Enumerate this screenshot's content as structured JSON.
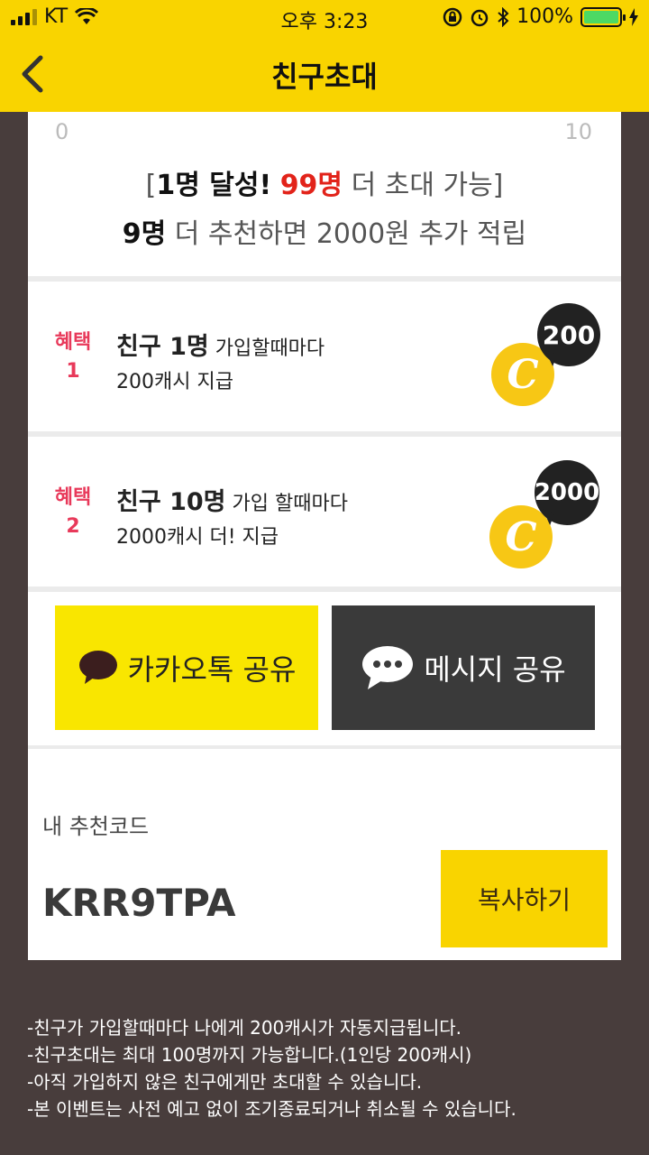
{
  "status": {
    "carrier": "KT",
    "time": "오후 3:23",
    "battery": "100%"
  },
  "nav": {
    "title": "친구초대"
  },
  "progress": {
    "min_label": "0",
    "max_label": "10",
    "line1_open": "[",
    "line1_bold": "1명 달성!",
    "line1_red": "99명",
    "line1_rest": "더 초대 가능",
    "line1_close": "]",
    "line2_bold": "9명",
    "line2_rest": "더 추천하면 2000원 추가 적립"
  },
  "benefits": [
    {
      "label_top": "혜택",
      "label_num": "1",
      "bold": "친구 1명",
      "rest": "가입할때마다",
      "line2": "200캐시 지급",
      "bubble": "200",
      "coin": "C"
    },
    {
      "label_top": "혜택",
      "label_num": "2",
      "bold": "친구 10명",
      "rest": "가입 할때마다",
      "line2": "2000캐시 더! 지급",
      "bubble": "2000",
      "coin": "C"
    }
  ],
  "share": {
    "kakao_label": "카카오톡 공유",
    "message_label": "메시지 공유"
  },
  "code": {
    "label": "내 추천코드",
    "value": "KRR9TPA",
    "copy_label": "복사하기"
  },
  "notes": [
    "-친구가 가입할때마다 나에게 200캐시가 자동지급됩니다.",
    "-친구초대는 최대 100명까지 가능합니다.(1인당 200캐시)",
    "-아직 가입하지 않은 친구에게만 초대할 수 있습니다.",
    "-본 이벤트는 사전 예고 없이 조기종료되거나 취소될 수 있습니다."
  ],
  "colors": {
    "brand_yellow": "#f9d400",
    "kakao_yellow": "#f9e600",
    "accent_red": "#e2231a",
    "benefit_pink": "#e8395a",
    "background": "#483d3c"
  },
  "icons": [
    "signal-icon",
    "wifi-icon",
    "back-chevron-icon",
    "kakao-bubble-icon",
    "message-bubble-icon",
    "coin-icon"
  ]
}
